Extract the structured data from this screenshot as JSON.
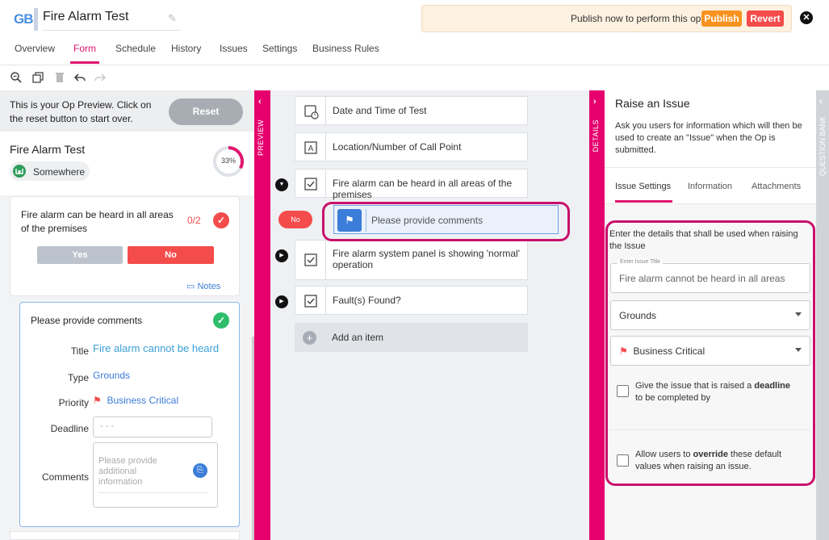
{
  "header": {
    "logo": "GB",
    "title": "Fire Alarm Test",
    "publish_banner": {
      "text": "Publish now to perform this op",
      "publish_label": "Publish",
      "revert_label": "Revert"
    }
  },
  "tabs": [
    {
      "label": "Overview"
    },
    {
      "label": "Form"
    },
    {
      "label": "Schedule"
    },
    {
      "label": "History"
    },
    {
      "label": "Issues"
    },
    {
      "label": "Settings"
    },
    {
      "label": "Business Rules"
    }
  ],
  "preview": {
    "info": "This is your Op Preview. Click on the reset button to start over.",
    "reset_label": "Reset",
    "op_title": "Fire Alarm Test",
    "location": "Somewhere",
    "progress_label": "33%",
    "progress": 0.33,
    "question": {
      "text": "Fire alarm can be heard in all areas of the premises",
      "count": "0/2",
      "yes_label": "Yes",
      "no_label": "No",
      "notes_label": "Notes"
    },
    "comment_card": {
      "title": "Please provide comments",
      "title_label": "Title",
      "title_value": "Fire alarm cannot be heard",
      "type_label": "Type",
      "type_value": "Grounds",
      "priority_label": "Priority",
      "priority_value": "Business Critical",
      "deadline_label": "Deadline",
      "deadline_placeholder": "- - -",
      "comments_label": "Comments",
      "comments_placeholder": "Please provide additional information"
    }
  },
  "strips": {
    "preview_label": "PREVIEW",
    "details_label": "DETAILS",
    "bank_label": "QUESTION BANK"
  },
  "form_items": [
    {
      "text": "Date and Time of Test"
    },
    {
      "text": "Location/Number of Call Point"
    },
    {
      "text": "Fire alarm can be heard in all areas of the premises"
    },
    {
      "text": "Fire alarm system panel is showing 'normal' operation"
    },
    {
      "text": "Fault(s) Found?"
    }
  ],
  "sub_item": {
    "condition": "No",
    "text": "Please provide comments"
  },
  "add_item_label": "Add an item",
  "details": {
    "title": "Raise an Issue",
    "description": "Ask you users for information which will then be used to create an \"Issue\" when the Op is submitted.",
    "tabs": [
      {
        "label": "Issue Settings"
      },
      {
        "label": "Information"
      },
      {
        "label": "Attachments"
      }
    ],
    "instruction": "Enter the details that shall be used when raising the Issue",
    "title_field_label": "Enter Issue Title",
    "title_field_value": "Fire alarm cannot be heard in all areas",
    "type_value": "Grounds",
    "priority_value": "Business Critical",
    "deadline_pre": "Give the issue that is raised a ",
    "deadline_bold": "deadline",
    "deadline_post": " to be completed by",
    "override_pre": "Allow users to ",
    "override_bold": "override",
    "override_post": " these default values when raising an issue."
  },
  "colors": {
    "accent": "#e0156e",
    "danger": "#f44b4b",
    "success": "#2ebd6b",
    "link": "#3b7dd8"
  }
}
